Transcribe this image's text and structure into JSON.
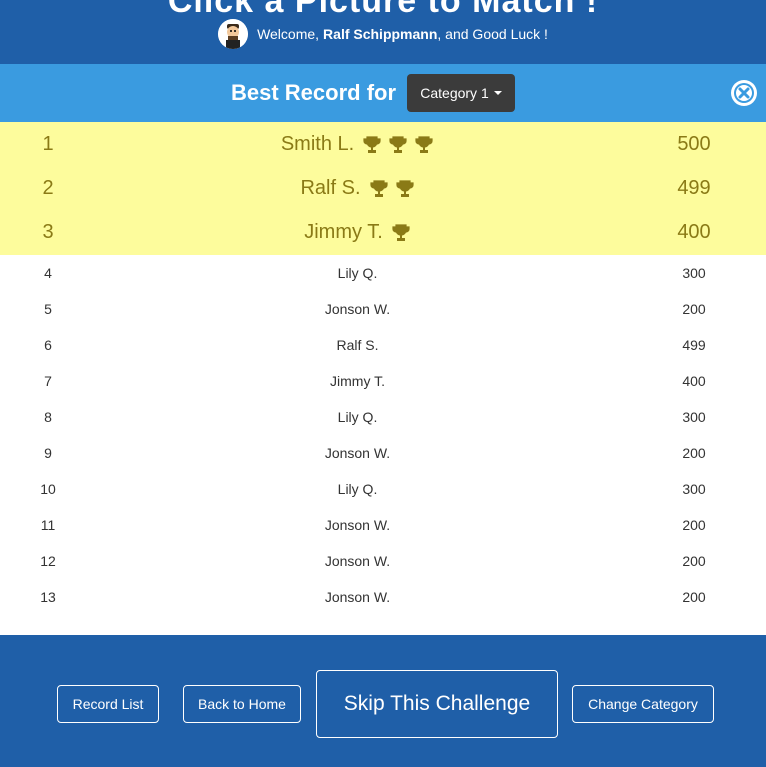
{
  "header": {
    "title": "Click a Picture to Match !",
    "welcome_prefix": "Welcome,",
    "user_name": "Ralf Schippmann",
    "welcome_suffix": ", and Good Luck !"
  },
  "record_bar": {
    "title": "Best Record for",
    "category_selected": "Category 1",
    "close_icon": "close-circle-icon"
  },
  "podium": [
    {
      "rank": "1",
      "name": "Smith L.",
      "score": "500",
      "trophies": 3
    },
    {
      "rank": "2",
      "name": "Ralf S.",
      "score": "499",
      "trophies": 2
    },
    {
      "rank": "3",
      "name": "Jimmy T.",
      "score": "400",
      "trophies": 1
    }
  ],
  "records": [
    {
      "rank": "4",
      "name": "Lily Q.",
      "score": "300"
    },
    {
      "rank": "5",
      "name": "Jonson W.",
      "score": "200"
    },
    {
      "rank": "6",
      "name": "Ralf S.",
      "score": "499"
    },
    {
      "rank": "7",
      "name": "Jimmy T.",
      "score": "400"
    },
    {
      "rank": "8",
      "name": "Lily Q.",
      "score": "300"
    },
    {
      "rank": "9",
      "name": "Jonson W.",
      "score": "200"
    },
    {
      "rank": "10",
      "name": "Lily Q.",
      "score": "300"
    },
    {
      "rank": "11",
      "name": "Jonson W.",
      "score": "200"
    },
    {
      "rank": "12",
      "name": "Jonson W.",
      "score": "200"
    },
    {
      "rank": "13",
      "name": "Jonson W.",
      "score": "200"
    }
  ],
  "footer": {
    "record_list": "Record List",
    "back_home": "Back to Home",
    "skip": "Skip This Challenge",
    "change_category": "Change Category"
  },
  "colors": {
    "header_blue": "#1f5fa8",
    "bar_blue": "#3a9be0",
    "podium_yellow": "#fdfc9c",
    "podium_text": "#8a7a16"
  }
}
